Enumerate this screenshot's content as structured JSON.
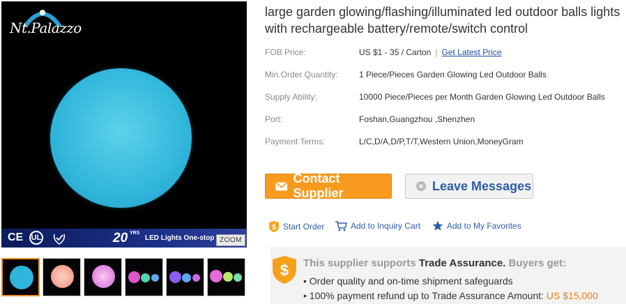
{
  "product": {
    "title": "large garden glowing/flashing/illuminated led outdoor balls lights with rechargeable battery/remote/switch control"
  },
  "image": {
    "logo_text": "Nt.Palazzo",
    "strip_certs": [
      "CE",
      "C",
      "UL"
    ],
    "strip_years": "20",
    "strip_years_suffix": "YRS",
    "strip_text": "LED Lights One-stop S",
    "zoom_label": "ZOOM",
    "ball_color": "#35b9dd"
  },
  "thumbnails": [
    {
      "index": 0,
      "active": true
    },
    {
      "index": 1,
      "active": false
    },
    {
      "index": 2,
      "active": false
    },
    {
      "index": 3,
      "active": false
    },
    {
      "index": 4,
      "active": false
    },
    {
      "index": 5,
      "active": false
    }
  ],
  "specs": {
    "fob": {
      "label": "FOB Price:",
      "value": "US $1 - 35 / Carton",
      "separator": "|",
      "link": "Get Latest Price"
    },
    "min_order": {
      "label": "Min.Order Quantity:",
      "value": "1 Piece/Pieces Garden Glowing Led Outdoor Balls"
    },
    "supply": {
      "label": "Supply Ability:",
      "value": "10000 Piece/Pieces per Month Garden Glowing Led Outdoor Balls"
    },
    "port": {
      "label": "Port:",
      "value": "Foshan,Guangzhou ,Shenzhen"
    },
    "payment": {
      "label": "Payment Terms:",
      "value": "L/C,D/A,D/P,T/T,Western Union,MoneyGram"
    }
  },
  "buttons": {
    "contact": "Contact Supplier",
    "message": "Leave Messages"
  },
  "actions": {
    "start_order": "Start Order",
    "inquiry_cart": "Add to Inquiry Cart",
    "favorites": "Add to My Favorites"
  },
  "assurance": {
    "lead": "This supplier supports",
    "brand": "Trade Assurance.",
    "tail": "Buyers get:",
    "bullet1": "Order quality and on-time shipment safeguards",
    "bullet2_prefix": "100% payment refund up to Trade Assurance Amount:",
    "bullet2_amount": "US $15,000"
  },
  "colors": {
    "accent": "#f79a1e",
    "link": "#2c5ea7",
    "amount": "#f07b1a"
  }
}
